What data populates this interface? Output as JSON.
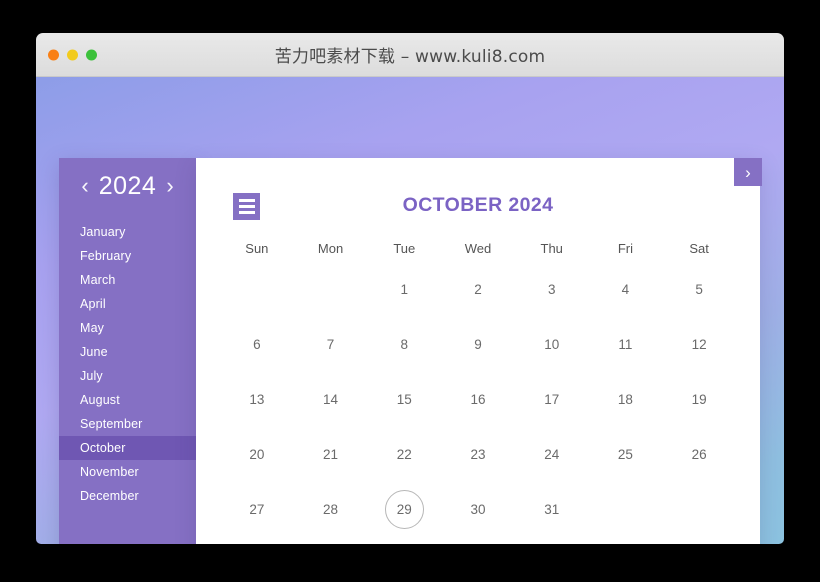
{
  "window": {
    "title": "苦力吧素材下载 – www.kuli8.com",
    "controls": [
      {
        "name": "close",
        "color": "#f98016"
      },
      {
        "name": "minimize",
        "color": "#f2cb1c"
      },
      {
        "name": "maximize",
        "color": "#3cc13b"
      }
    ]
  },
  "sidebar": {
    "prev_arrow": "‹",
    "next_arrow": "›",
    "year": "2024",
    "months": [
      {
        "label": "January",
        "active": false
      },
      {
        "label": "February",
        "active": false
      },
      {
        "label": "March",
        "active": false
      },
      {
        "label": "April",
        "active": false
      },
      {
        "label": "May",
        "active": false
      },
      {
        "label": "June",
        "active": false
      },
      {
        "label": "July",
        "active": false
      },
      {
        "label": "August",
        "active": false
      },
      {
        "label": "September",
        "active": false
      },
      {
        "label": "October",
        "active": true
      },
      {
        "label": "November",
        "active": false
      },
      {
        "label": "December",
        "active": false
      }
    ]
  },
  "toolbar": {
    "menu_icon": "hamburger-icon",
    "next_icon": "›"
  },
  "calendar": {
    "title": "OCTOBER 2024",
    "weekdays": [
      "Sun",
      "Mon",
      "Tue",
      "Wed",
      "Thu",
      "Fri",
      "Sat"
    ],
    "weeks": [
      [
        "",
        "",
        "1",
        "2",
        "3",
        "4",
        "5"
      ],
      [
        "6",
        "7",
        "8",
        "9",
        "10",
        "11",
        "12"
      ],
      [
        "13",
        "14",
        "15",
        "16",
        "17",
        "18",
        "19"
      ],
      [
        "20",
        "21",
        "22",
        "23",
        "24",
        "25",
        "26"
      ],
      [
        "27",
        "28",
        "29",
        "30",
        "31",
        "",
        ""
      ]
    ],
    "today": "29"
  },
  "colors": {
    "sidebar_bg": "#8570c4",
    "sidebar_active": "#6f57b3",
    "accent": "#7b63c4",
    "card_bg": "#ffffff"
  }
}
